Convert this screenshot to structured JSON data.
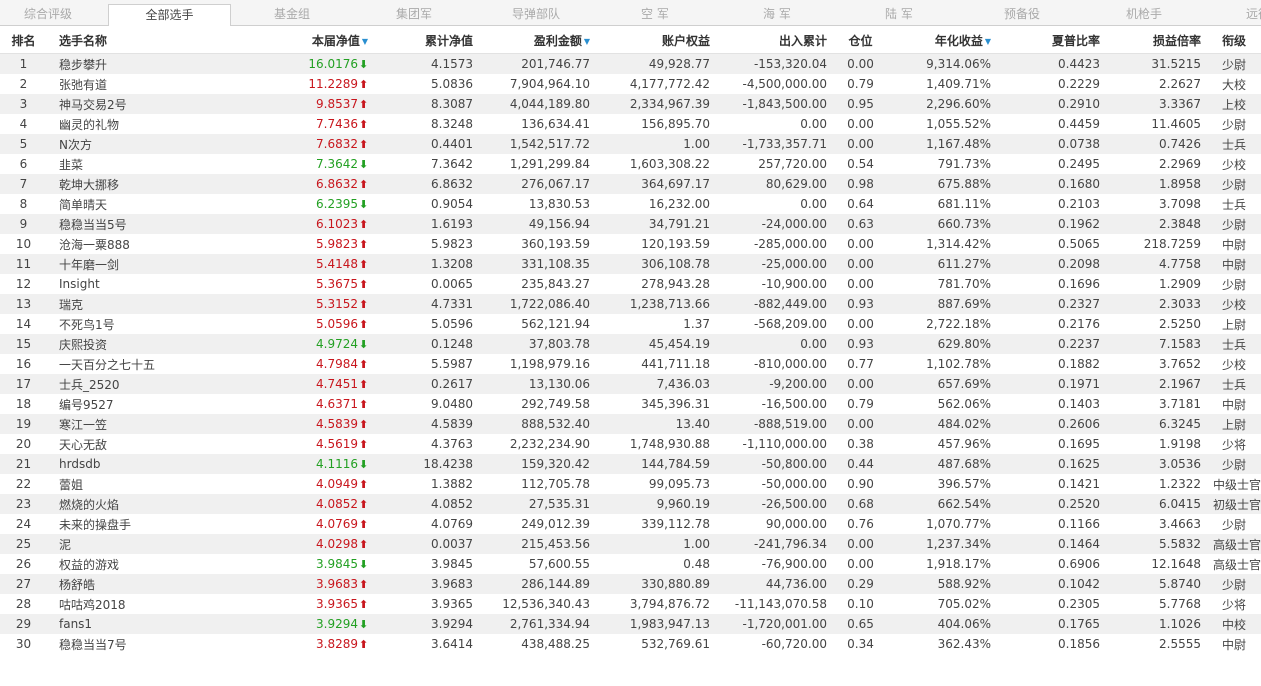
{
  "tabs": [
    {
      "label": "综合评级",
      "active": false
    },
    {
      "label": "全部选手",
      "active": true
    },
    {
      "label": "基金组",
      "active": false
    },
    {
      "label": "集团军",
      "active": false
    },
    {
      "label": "导弹部队",
      "active": false
    },
    {
      "label": "空  军",
      "active": false
    },
    {
      "label": "海  军",
      "active": false
    },
    {
      "label": "陆  军",
      "active": false
    },
    {
      "label": "预备役",
      "active": false
    },
    {
      "label": "机枪手",
      "active": false
    },
    {
      "label": "远征",
      "active": false
    }
  ],
  "headers": {
    "rank": "排名",
    "name": "选手名称",
    "nav": "本届净值",
    "cum_nav": "累计净值",
    "profit": "盈利金额",
    "equity": "账户权益",
    "flow": "出入累计",
    "position": "仓位",
    "annual": "年化收益",
    "sharpe": "夏普比率",
    "pl_ratio": "损益倍率",
    "title": "衔级"
  },
  "sort_icon": "sort-desc-icon",
  "colors": {
    "up": "#c8161d",
    "down": "#23a023",
    "accent": "#2a8fd0"
  },
  "rows": [
    {
      "rank": "1",
      "name": "稳步攀升",
      "nav": "16.0176",
      "trend": "down",
      "cum_nav": "4.1573",
      "profit": "201,746.77",
      "equity": "49,928.77",
      "flow": "-153,320.04",
      "position": "0.00",
      "annual": "9,314.06%",
      "sharpe": "0.4423",
      "pl_ratio": "31.5215",
      "title": "少尉"
    },
    {
      "rank": "2",
      "name": "张弛有道",
      "nav": "11.2289",
      "trend": "up",
      "cum_nav": "5.0836",
      "profit": "7,904,964.10",
      "equity": "4,177,772.42",
      "flow": "-4,500,000.00",
      "position": "0.79",
      "annual": "1,409.71%",
      "sharpe": "0.2229",
      "pl_ratio": "2.2627",
      "title": "大校"
    },
    {
      "rank": "3",
      "name": "神马交易2号",
      "nav": "9.8537",
      "trend": "up",
      "cum_nav": "8.3087",
      "profit": "4,044,189.80",
      "equity": "2,334,967.39",
      "flow": "-1,843,500.00",
      "position": "0.95",
      "annual": "2,296.60%",
      "sharpe": "0.2910",
      "pl_ratio": "3.3367",
      "title": "上校"
    },
    {
      "rank": "4",
      "name": "幽灵的礼物",
      "nav": "7.7436",
      "trend": "up",
      "cum_nav": "8.3248",
      "profit": "136,634.41",
      "equity": "156,895.70",
      "flow": "0.00",
      "position": "0.00",
      "annual": "1,055.52%",
      "sharpe": "0.4459",
      "pl_ratio": "11.4605",
      "title": "少尉"
    },
    {
      "rank": "5",
      "name": "N次方",
      "nav": "7.6832",
      "trend": "up",
      "cum_nav": "0.4401",
      "profit": "1,542,517.72",
      "equity": "1.00",
      "flow": "-1,733,357.71",
      "position": "0.00",
      "annual": "1,167.48%",
      "sharpe": "0.0738",
      "pl_ratio": "0.7426",
      "title": "士兵"
    },
    {
      "rank": "6",
      "name": "韭菜",
      "nav": "7.3642",
      "trend": "down",
      "cum_nav": "7.3642",
      "profit": "1,291,299.84",
      "equity": "1,603,308.22",
      "flow": "257,720.00",
      "position": "0.54",
      "annual": "791.73%",
      "sharpe": "0.2495",
      "pl_ratio": "2.2969",
      "title": "少校"
    },
    {
      "rank": "7",
      "name": "乾坤大挪移",
      "nav": "6.8632",
      "trend": "up",
      "cum_nav": "6.8632",
      "profit": "276,067.17",
      "equity": "364,697.17",
      "flow": "80,629.00",
      "position": "0.98",
      "annual": "675.88%",
      "sharpe": "0.1680",
      "pl_ratio": "1.8958",
      "title": "少尉"
    },
    {
      "rank": "8",
      "name": "简单晴天",
      "nav": "6.2395",
      "trend": "down",
      "cum_nav": "0.9054",
      "profit": "13,830.53",
      "equity": "16,232.00",
      "flow": "0.00",
      "position": "0.64",
      "annual": "681.11%",
      "sharpe": "0.2103",
      "pl_ratio": "3.7098",
      "title": "士兵"
    },
    {
      "rank": "9",
      "name": "稳稳当当5号",
      "nav": "6.1023",
      "trend": "up",
      "cum_nav": "1.6193",
      "profit": "49,156.94",
      "equity": "34,791.21",
      "flow": "-24,000.00",
      "position": "0.63",
      "annual": "660.73%",
      "sharpe": "0.1962",
      "pl_ratio": "2.3848",
      "title": "少尉"
    },
    {
      "rank": "10",
      "name": "沧海一粟888",
      "nav": "5.9823",
      "trend": "up",
      "cum_nav": "5.9823",
      "profit": "360,193.59",
      "equity": "120,193.59",
      "flow": "-285,000.00",
      "position": "0.00",
      "annual": "1,314.42%",
      "sharpe": "0.5065",
      "pl_ratio": "218.7259",
      "title": "中尉"
    },
    {
      "rank": "11",
      "name": "十年磨一剑",
      "nav": "5.4148",
      "trend": "up",
      "cum_nav": "1.3208",
      "profit": "331,108.35",
      "equity": "306,108.78",
      "flow": "-25,000.00",
      "position": "0.00",
      "annual": "611.27%",
      "sharpe": "0.2098",
      "pl_ratio": "4.7758",
      "title": "中尉"
    },
    {
      "rank": "12",
      "name": "Insight",
      "nav": "5.3675",
      "trend": "up",
      "cum_nav": "0.0065",
      "profit": "235,843.27",
      "equity": "278,943.28",
      "flow": "-10,900.00",
      "position": "0.00",
      "annual": "781.70%",
      "sharpe": "0.1696",
      "pl_ratio": "1.2909",
      "title": "少尉"
    },
    {
      "rank": "13",
      "name": "瑞克",
      "nav": "5.3152",
      "trend": "up",
      "cum_nav": "4.7331",
      "profit": "1,722,086.40",
      "equity": "1,238,713.66",
      "flow": "-882,449.00",
      "position": "0.93",
      "annual": "887.69%",
      "sharpe": "0.2327",
      "pl_ratio": "2.3033",
      "title": "少校"
    },
    {
      "rank": "14",
      "name": "不死鸟1号",
      "nav": "5.0596",
      "trend": "up",
      "cum_nav": "5.0596",
      "profit": "562,121.94",
      "equity": "1.37",
      "flow": "-568,209.00",
      "position": "0.00",
      "annual": "2,722.18%",
      "sharpe": "0.2176",
      "pl_ratio": "2.5250",
      "title": "上尉"
    },
    {
      "rank": "15",
      "name": "庆熙投资",
      "nav": "4.9724",
      "trend": "down",
      "cum_nav": "0.1248",
      "profit": "37,803.78",
      "equity": "45,454.19",
      "flow": "0.00",
      "position": "0.93",
      "annual": "629.80%",
      "sharpe": "0.2237",
      "pl_ratio": "7.1583",
      "title": "士兵"
    },
    {
      "rank": "16",
      "name": "一天百分之七十五",
      "nav": "4.7984",
      "trend": "up",
      "cum_nav": "5.5987",
      "profit": "1,198,979.16",
      "equity": "441,711.18",
      "flow": "-810,000.00",
      "position": "0.77",
      "annual": "1,102.78%",
      "sharpe": "0.1882",
      "pl_ratio": "3.7652",
      "title": "少校"
    },
    {
      "rank": "17",
      "name": "士兵_2520",
      "nav": "4.7451",
      "trend": "up",
      "cum_nav": "0.2617",
      "profit": "13,130.06",
      "equity": "7,436.03",
      "flow": "-9,200.00",
      "position": "0.00",
      "annual": "657.69%",
      "sharpe": "0.1971",
      "pl_ratio": "2.1967",
      "title": "士兵"
    },
    {
      "rank": "18",
      "name": "编号9527",
      "nav": "4.6371",
      "trend": "up",
      "cum_nav": "9.0480",
      "profit": "292,749.58",
      "equity": "345,396.31",
      "flow": "-16,500.00",
      "position": "0.79",
      "annual": "562.06%",
      "sharpe": "0.1403",
      "pl_ratio": "3.7181",
      "title": "中尉"
    },
    {
      "rank": "19",
      "name": "寒江一笠",
      "nav": "4.5839",
      "trend": "up",
      "cum_nav": "4.5839",
      "profit": "888,532.40",
      "equity": "13.40",
      "flow": "-888,519.00",
      "position": "0.00",
      "annual": "484.02%",
      "sharpe": "0.2606",
      "pl_ratio": "6.3245",
      "title": "上尉"
    },
    {
      "rank": "20",
      "name": "天心无敌",
      "nav": "4.5619",
      "trend": "up",
      "cum_nav": "4.3763",
      "profit": "2,232,234.90",
      "equity": "1,748,930.88",
      "flow": "-1,110,000.00",
      "position": "0.38",
      "annual": "457.96%",
      "sharpe": "0.1695",
      "pl_ratio": "1.9198",
      "title": "少将"
    },
    {
      "rank": "21",
      "name": "hrdsdb",
      "nav": "4.1116",
      "trend": "down",
      "cum_nav": "18.4238",
      "profit": "159,320.42",
      "equity": "144,784.59",
      "flow": "-50,800.00",
      "position": "0.44",
      "annual": "487.68%",
      "sharpe": "0.1625",
      "pl_ratio": "3.0536",
      "title": "少尉"
    },
    {
      "rank": "22",
      "name": "蕾姐",
      "nav": "4.0949",
      "trend": "up",
      "cum_nav": "1.3882",
      "profit": "112,705.78",
      "equity": "99,095.73",
      "flow": "-50,000.00",
      "position": "0.90",
      "annual": "396.57%",
      "sharpe": "0.1421",
      "pl_ratio": "1.2322",
      "title": "中级士官"
    },
    {
      "rank": "23",
      "name": "燃烧的火焰",
      "nav": "4.0852",
      "trend": "up",
      "cum_nav": "4.0852",
      "profit": "27,535.31",
      "equity": "9,960.19",
      "flow": "-26,500.00",
      "position": "0.68",
      "annual": "662.54%",
      "sharpe": "0.2520",
      "pl_ratio": "6.0415",
      "title": "初级士官"
    },
    {
      "rank": "24",
      "name": "未来的操盘手",
      "nav": "4.0769",
      "trend": "up",
      "cum_nav": "4.0769",
      "profit": "249,012.39",
      "equity": "339,112.78",
      "flow": "90,000.00",
      "position": "0.76",
      "annual": "1,070.77%",
      "sharpe": "0.1166",
      "pl_ratio": "3.4663",
      "title": "少尉"
    },
    {
      "rank": "25",
      "name": "泥",
      "nav": "4.0298",
      "trend": "up",
      "cum_nav": "0.0037",
      "profit": "215,453.56",
      "equity": "1.00",
      "flow": "-241,796.34",
      "position": "0.00",
      "annual": "1,237.34%",
      "sharpe": "0.1464",
      "pl_ratio": "5.5832",
      "title": "高级士官"
    },
    {
      "rank": "26",
      "name": "权益的游戏",
      "nav": "3.9845",
      "trend": "down",
      "cum_nav": "3.9845",
      "profit": "57,600.55",
      "equity": "0.48",
      "flow": "-76,900.00",
      "position": "0.00",
      "annual": "1,918.17%",
      "sharpe": "0.6906",
      "pl_ratio": "12.1648",
      "title": "高级士官"
    },
    {
      "rank": "27",
      "name": "杨舒皓",
      "nav": "3.9683",
      "trend": "up",
      "cum_nav": "3.9683",
      "profit": "286,144.89",
      "equity": "330,880.89",
      "flow": "44,736.00",
      "position": "0.29",
      "annual": "588.92%",
      "sharpe": "0.1042",
      "pl_ratio": "5.8740",
      "title": "少尉"
    },
    {
      "rank": "28",
      "name": "咕咕鸡2018",
      "nav": "3.9365",
      "trend": "up",
      "cum_nav": "3.9365",
      "profit": "12,536,340.43",
      "equity": "3,794,876.72",
      "flow": "-11,143,070.58",
      "position": "0.10",
      "annual": "705.02%",
      "sharpe": "0.2305",
      "pl_ratio": "5.7768",
      "title": "少将"
    },
    {
      "rank": "29",
      "name": "fans1",
      "nav": "3.9294",
      "trend": "down",
      "cum_nav": "3.9294",
      "profit": "2,761,334.94",
      "equity": "1,983,947.13",
      "flow": "-1,720,001.00",
      "position": "0.65",
      "annual": "404.06%",
      "sharpe": "0.1765",
      "pl_ratio": "1.1026",
      "title": "中校"
    },
    {
      "rank": "30",
      "name": "稳稳当当7号",
      "nav": "3.8289",
      "trend": "up",
      "cum_nav": "3.6414",
      "profit": "438,488.25",
      "equity": "532,769.61",
      "flow": "-60,720.00",
      "position": "0.34",
      "annual": "362.43%",
      "sharpe": "0.1856",
      "pl_ratio": "2.5555",
      "title": "中尉"
    }
  ]
}
